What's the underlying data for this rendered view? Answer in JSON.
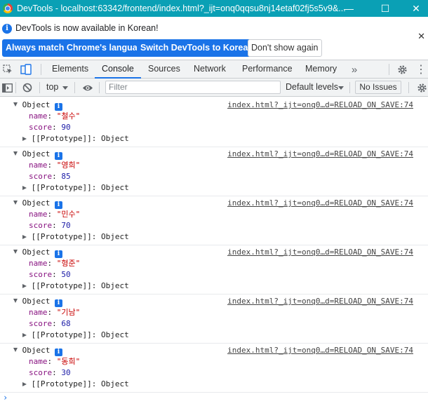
{
  "window": {
    "title": "DevTools - localhost:63342/frontend/index.html?_ijt=onq0qqsu8nj14etaf02fj5s5v9&...",
    "minimize_glyph": "—",
    "maximize_glyph": "☐",
    "close_glyph": "✕"
  },
  "infobar": {
    "message": "DevTools is now available in Korean!",
    "buttons": [
      "Always match Chrome's language",
      "Switch DevTools to Korean",
      "Don't show again"
    ],
    "close_glyph": "✕"
  },
  "tabs": {
    "items": [
      "Elements",
      "Console",
      "Sources",
      "Network",
      "Performance",
      "Memory"
    ],
    "active": "Console",
    "more_glyph": "»",
    "kebab_glyph": "⋮"
  },
  "console_toolbar": {
    "context": "top",
    "filter_placeholder": "Filter",
    "levels": "Default levels",
    "issues": "No Issues"
  },
  "messages": [
    {
      "label": "Object",
      "source": "index.html?_ijt=onq0…d=RELOAD_ON_SAVE:74",
      "name": "\"철수\"",
      "score": "90",
      "proto": "[[Prototype]]: Object"
    },
    {
      "label": "Object",
      "source": "index.html?_ijt=onq0…d=RELOAD_ON_SAVE:74",
      "name": "\"영희\"",
      "score": "85",
      "proto": "[[Prototype]]: Object"
    },
    {
      "label": "Object",
      "source": "index.html?_ijt=onq0…d=RELOAD_ON_SAVE:74",
      "name": "\"민수\"",
      "score": "70",
      "proto": "[[Prototype]]: Object"
    },
    {
      "label": "Object",
      "source": "index.html?_ijt=onq0…d=RELOAD_ON_SAVE:74",
      "name": "\"형준\"",
      "score": "50",
      "proto": "[[Prototype]]: Object"
    },
    {
      "label": "Object",
      "source": "index.html?_ijt=onq0…d=RELOAD_ON_SAVE:74",
      "name": "\"기남\"",
      "score": "68",
      "proto": "[[Prototype]]: Object"
    },
    {
      "label": "Object",
      "source": "index.html?_ijt=onq0…d=RELOAD_ON_SAVE:74",
      "name": "\"동희\"",
      "score": "30",
      "proto": "[[Prototype]]: Object"
    }
  ],
  "labels": {
    "name_key": "name",
    "score_key": "score",
    "prompt_glyph": "›"
  },
  "colors": {
    "titlebar": "#0aa0b5",
    "accent": "#1a73e8",
    "key": "#881280",
    "string": "#c80000",
    "number": "#1a1aa6"
  }
}
